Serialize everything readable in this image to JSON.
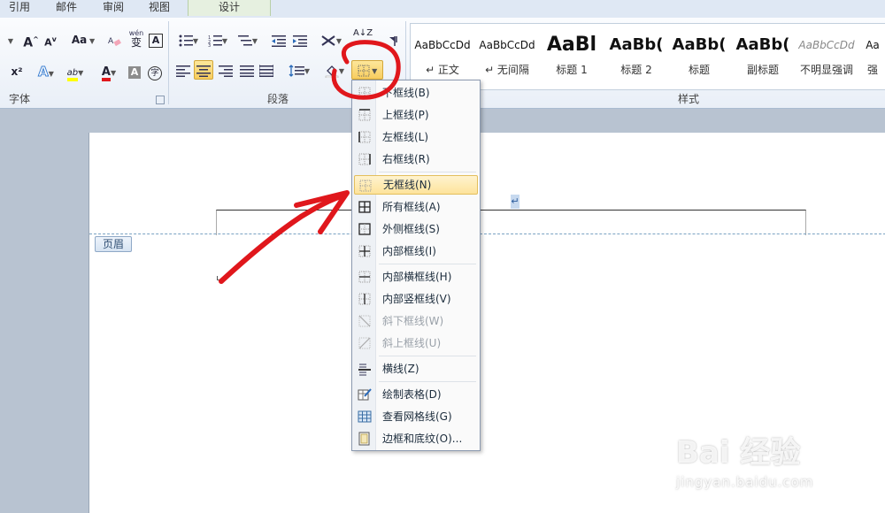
{
  "tabs": [
    {
      "label": "引用"
    },
    {
      "label": "邮件"
    },
    {
      "label": "审阅"
    },
    {
      "label": "视图"
    },
    {
      "label": "设计"
    }
  ],
  "ribbon": {
    "groups": {
      "font": "字体",
      "paragraph": "段落",
      "styles": "样式"
    },
    "font_tools": {
      "grow": "A",
      "shrink": "A",
      "case": "Aa",
      "phonetic": "wén",
      "phonetic_char": "变",
      "border_char": "A",
      "superscript": "x²",
      "effects": "A",
      "highlight": "ab",
      "font_color": "A",
      "shading_char": "A",
      "enclose_char": "字"
    },
    "paragraph_tools": {
      "sort": "A↓Z"
    },
    "styles": [
      {
        "sample": "AaBbCcDd",
        "name": "↵ 正文"
      },
      {
        "sample": "AaBbCcDd",
        "name": "↵ 无间隔"
      },
      {
        "sample": "AaBl",
        "name": "标题 1"
      },
      {
        "sample": "AaBb(",
        "name": "标题 2"
      },
      {
        "sample": "AaBb(",
        "name": "标题"
      },
      {
        "sample": "AaBb(",
        "name": "副标题"
      },
      {
        "sample": "AaBbCcDd",
        "name": "不明显强调"
      },
      {
        "sample": "Aa",
        "name": "强"
      }
    ]
  },
  "document": {
    "header_tag": "页眉",
    "para_mark": "↵"
  },
  "border_menu": {
    "items": [
      {
        "label": "下框线(B)",
        "icon": "bottom-border-icon",
        "enabled": true
      },
      {
        "label": "上框线(P)",
        "icon": "top-border-icon",
        "enabled": true
      },
      {
        "label": "左框线(L)",
        "icon": "left-border-icon",
        "enabled": true
      },
      {
        "label": "右框线(R)",
        "icon": "right-border-icon",
        "enabled": true
      },
      {
        "label": "无框线(N)",
        "icon": "no-border-icon",
        "enabled": true,
        "highlighted": true
      },
      {
        "label": "所有框线(A)",
        "icon": "all-borders-icon",
        "enabled": true
      },
      {
        "label": "外侧框线(S)",
        "icon": "outside-borders-icon",
        "enabled": true
      },
      {
        "label": "内部框线(I)",
        "icon": "inside-borders-icon",
        "enabled": true
      },
      {
        "label": "内部横框线(H)",
        "icon": "inside-horizontal-border-icon",
        "enabled": true
      },
      {
        "label": "内部竖框线(V)",
        "icon": "inside-vertical-border-icon",
        "enabled": true
      },
      {
        "label": "斜下框线(W)",
        "icon": "diagonal-down-border-icon",
        "enabled": false
      },
      {
        "label": "斜上框线(U)",
        "icon": "diagonal-up-border-icon",
        "enabled": false
      },
      {
        "label": "横线(Z)",
        "icon": "horizontal-line-icon",
        "enabled": true
      },
      {
        "label": "绘制表格(D)",
        "icon": "draw-table-icon",
        "enabled": true
      },
      {
        "label": "查看网格线(G)",
        "icon": "view-gridlines-icon",
        "enabled": true
      },
      {
        "label": "边框和底纹(O)...",
        "icon": "borders-shading-icon",
        "enabled": true
      }
    ]
  },
  "watermark": {
    "brand": "Bai 经验",
    "url": "jingyan.baidu.com"
  },
  "colors": {
    "accent_highlight": "#f8cd5e",
    "annotation_red": "#e0171c",
    "highlighter_yellow": "#ffff00",
    "font_color_red": "#e0171c"
  }
}
